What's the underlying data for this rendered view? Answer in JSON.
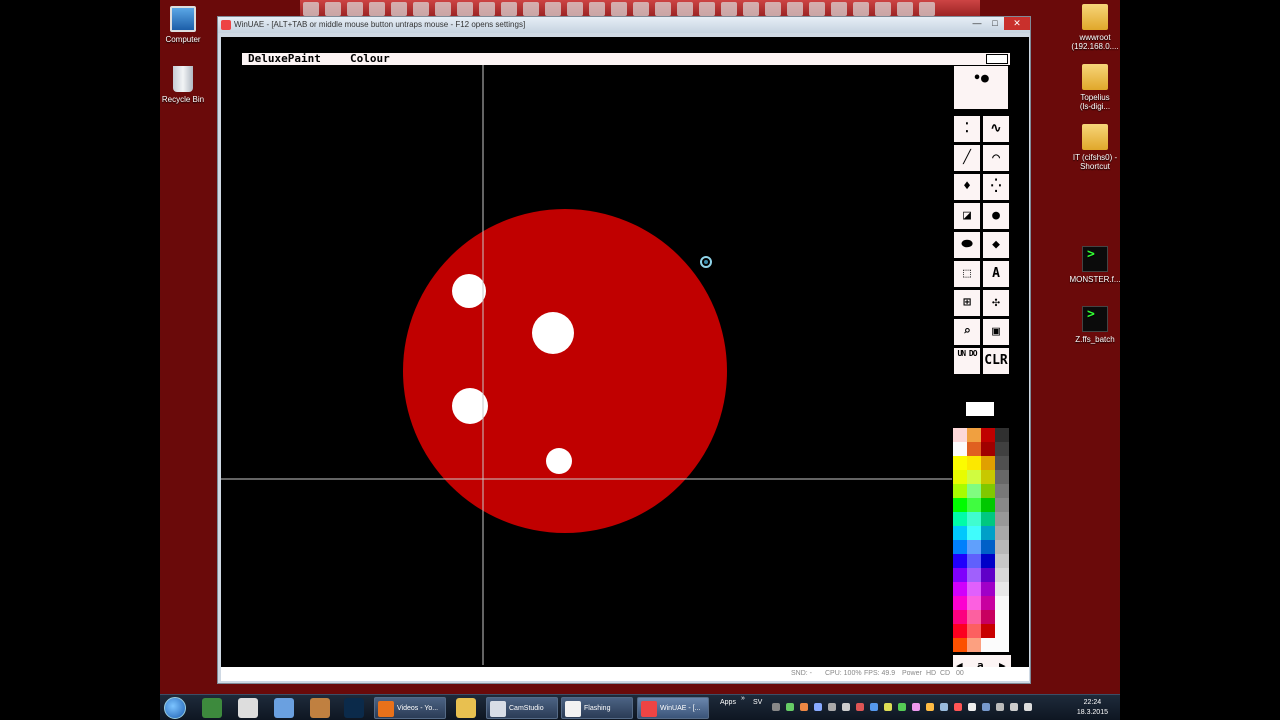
{
  "desktop": {
    "left_icons": [
      {
        "label": "Computer",
        "icon": "computer-icon"
      },
      {
        "label": "Recycle Bin",
        "icon": "recycle-bin-icon"
      }
    ],
    "right_icons": [
      {
        "line1": "wwwroot",
        "line2": "(192.168.0....",
        "icon": "folder-shortcut-icon"
      },
      {
        "line1": "Topelius",
        "line2": "(ls-digi...",
        "icon": "folder-shortcut-icon"
      },
      {
        "line1": "IT (cifshs0) -",
        "line2": "Shortcut",
        "icon": "folder-shortcut-icon"
      },
      {
        "line1": "MONSTER.f...",
        "line2": "",
        "icon": "batch-file-icon"
      },
      {
        "line1": "Z.ffs_batch",
        "line2": "",
        "icon": "batch-file-icon"
      }
    ]
  },
  "window": {
    "title": "WinUAE - [ALT+TAB or middle mouse button untraps mouse - F12 opens settings]",
    "min_glyph": "—",
    "max_glyph": "□",
    "close_glyph": "✕"
  },
  "amiga": {
    "menu": {
      "app": "DeluxePaint",
      "item": "Colour"
    },
    "canvas": {
      "background": "#000000",
      "circle_color": "#c00000",
      "dot_color": "#ffffff",
      "crosshair_color": "#c8c8c8",
      "cursor_icon": "busy-cursor-icon"
    },
    "tools": [
      {
        "name": "brush-sizes",
        "glyph": "•●"
      },
      {
        "name": "dotted-freehand",
        "glyph": "⁚"
      },
      {
        "name": "continuous-freehand",
        "glyph": "∿"
      },
      {
        "name": "straight-line",
        "glyph": "╱"
      },
      {
        "name": "curve",
        "glyph": "⌒"
      },
      {
        "name": "fill",
        "glyph": "♦"
      },
      {
        "name": "airbrush",
        "glyph": "⁛"
      },
      {
        "name": "rectangle",
        "glyph": "◪"
      },
      {
        "name": "circle",
        "glyph": "●"
      },
      {
        "name": "ellipse",
        "glyph": "⬬"
      },
      {
        "name": "polygon",
        "glyph": "◆"
      },
      {
        "name": "brush-select",
        "glyph": "⬚"
      },
      {
        "name": "text",
        "glyph": "A"
      },
      {
        "name": "grid",
        "glyph": "⊞"
      },
      {
        "name": "symmetry",
        "glyph": "✣"
      },
      {
        "name": "magnify",
        "glyph": "⌕"
      },
      {
        "name": "zoom",
        "glyph": "▣"
      },
      {
        "name": "undo",
        "glyph": "UN DO"
      },
      {
        "name": "clear",
        "glyph": "CLR"
      }
    ],
    "palette_columns": [
      [
        "#fcd8d8",
        "#fcfcfc",
        "#fcfc00",
        "#e8fc00",
        "#a8fc00",
        "#00fc00",
        "#00fca8",
        "#00c8fc",
        "#0080fc",
        "#2000fc",
        "#8000fc",
        "#d000fc",
        "#fc00d0",
        "#fc0080",
        "#fc0020",
        "#fc5000"
      ],
      [
        "#f0a040",
        "#e06020",
        "#fce800",
        "#d0fc40",
        "#80fc80",
        "#40fc40",
        "#40fcd0",
        "#40fcfc",
        "#60a0fc",
        "#6060fc",
        "#a060fc",
        "#e060fc",
        "#fc60e0",
        "#fc60a0",
        "#fc6060",
        "#fca080"
      ],
      [
        "#c00000",
        "#a00000",
        "#e0a000",
        "#c8c800",
        "#80c800",
        "#00c800",
        "#00c880",
        "#00a0c8",
        "#0060c8",
        "#0000c8",
        "#6000c8",
        "#a000c8",
        "#c800a0",
        "#c80060",
        "#c80000",
        "#fcfcfc"
      ],
      [
        "#303030",
        "#404040",
        "#505050",
        "#686868",
        "#787878",
        "#888888",
        "#989898",
        "#a8a8a8",
        "#b8b8b8",
        "#c8c8c8",
        "#d8d8d8",
        "#e8e8e8",
        "#f8f8f8",
        "#fcfcfc",
        "#fcfcfc",
        "#fcfcfc"
      ]
    ],
    "palette_footer": {
      "left_arrow": "◀",
      "letter": "a",
      "right_arrow": "▶"
    }
  },
  "statusbar": {
    "snd": "SND: -",
    "cpu": "CPU: 100%",
    "fps": "FPS: 49.9",
    "power": "Power",
    "hd": "HD",
    "cd": "CD",
    "df0": "00"
  },
  "taskbar": {
    "tasks": [
      "Videos - Yo...",
      "CamStudio",
      "Flashing",
      "WinUAE - [..."
    ],
    "apps_label": "Apps",
    "overflow": "»",
    "lang": "SV",
    "time": "22:24",
    "date": "18.3.2015"
  }
}
